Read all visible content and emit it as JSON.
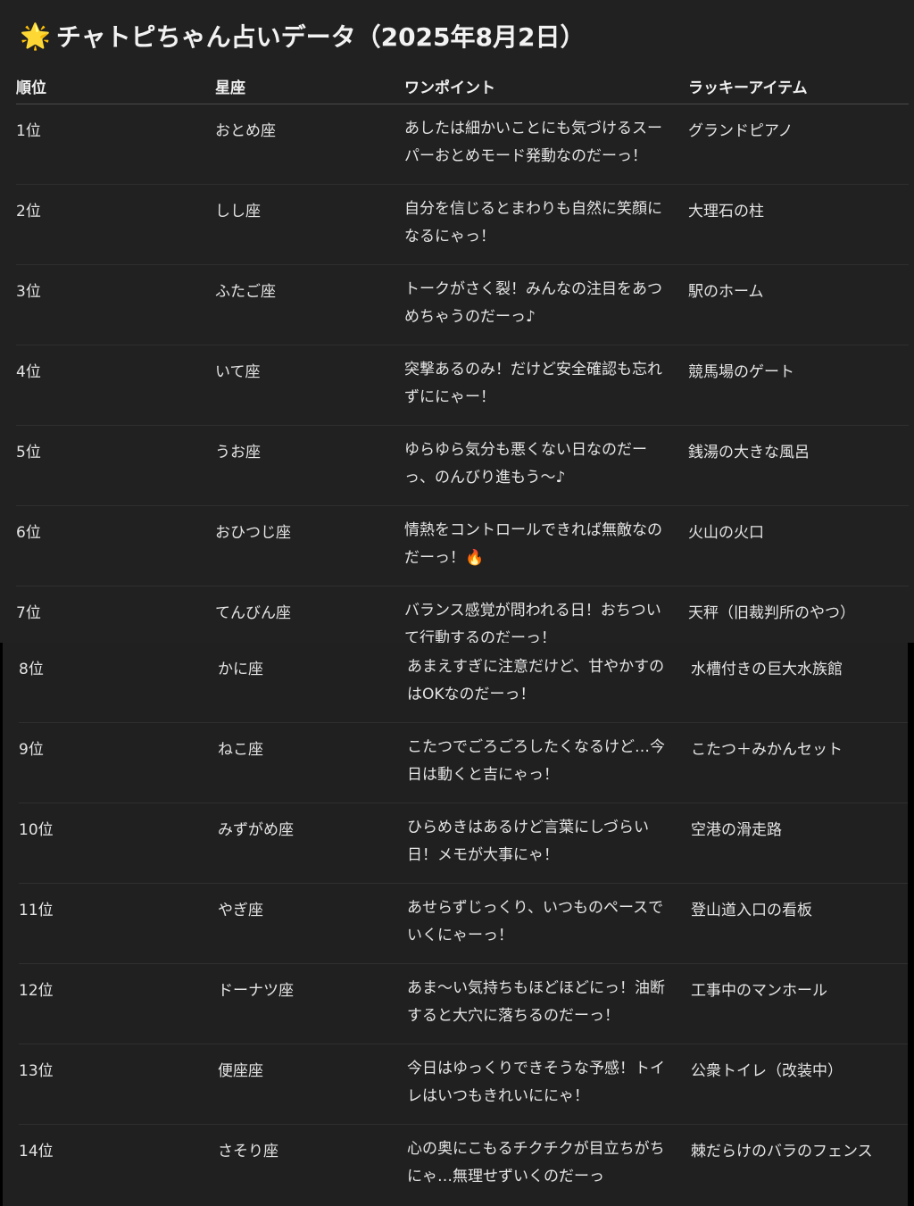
{
  "title": {
    "emoji": "🌟",
    "text": "チャトピちゃん占いデータ（2025年8月2日）"
  },
  "headers": {
    "rank": "順位",
    "sign": "星座",
    "point": "ワンポイント",
    "item": "ラッキーアイテム"
  },
  "rows_top": [
    {
      "rank": "1位",
      "sign": "おとめ座",
      "point": "あしたは細かいことにも気づけるスーパーおとめモード発動なのだーっ！",
      "item": "グランドピアノ"
    },
    {
      "rank": "2位",
      "sign": "しし座",
      "point": "自分を信じるとまわりも自然に笑顔になるにゃっ！",
      "item": "大理石の柱"
    },
    {
      "rank": "3位",
      "sign": "ふたご座",
      "point": "トークがさく裂！みんなの注目をあつめちゃうのだーっ♪",
      "item": "駅のホーム"
    },
    {
      "rank": "4位",
      "sign": "いて座",
      "point": "突撃あるのみ！だけど安全確認も忘れずににゃー！",
      "item": "競馬場のゲート"
    },
    {
      "rank": "5位",
      "sign": "うお座",
      "point": "ゆらゆら気分も悪くない日なのだーっ、のんびり進もう〜♪",
      "item": "銭湯の大きな風呂"
    },
    {
      "rank": "6位",
      "sign": "おひつじ座",
      "point": "情熱をコントロールできれば無敵なのだーっ！🔥",
      "item": "火山の火口"
    },
    {
      "rank": "7位",
      "sign": "てんびん座",
      "point": "バランス感覚が問われる日！おちついて行動するのだーっ！",
      "item": "天秤（旧裁判所のやつ）"
    }
  ],
  "rows_bottom": [
    {
      "rank": "8位",
      "sign": "かに座",
      "point": "あまえすぎに注意だけど、甘やかすのはOKなのだーっ！",
      "item": "水槽付きの巨大水族館"
    },
    {
      "rank": "9位",
      "sign": "ねこ座",
      "point": "こたつでごろごろしたくなるけど…今日は動くと吉にゃっ！",
      "item": "こたつ＋みかんセット"
    },
    {
      "rank": "10位",
      "sign": "みずがめ座",
      "point": "ひらめきはあるけど言葉にしづらい日！メモが大事にゃ！",
      "item": "空港の滑走路"
    },
    {
      "rank": "11位",
      "sign": "やぎ座",
      "point": "あせらずじっくり、いつものペースでいくにゃーっ！",
      "item": "登山道入口の看板"
    },
    {
      "rank": "12位",
      "sign": "ドーナツ座",
      "point": "あま〜い気持ちもほどほどにっ！油断すると大穴に落ちるのだーっ！",
      "item": "工事中のマンホール"
    },
    {
      "rank": "13位",
      "sign": "便座座",
      "point": "今日はゆっくりできそうな予感！トイレはいつもきれいににゃ！",
      "item": "公衆トイレ（改装中）"
    },
    {
      "rank": "14位",
      "sign": "さそり座",
      "point": "心の奥にこもるチクチクが目立ちがちにゃ…無理せずいくのだーっ",
      "item": "棘だらけのバラのフェンス"
    }
  ]
}
